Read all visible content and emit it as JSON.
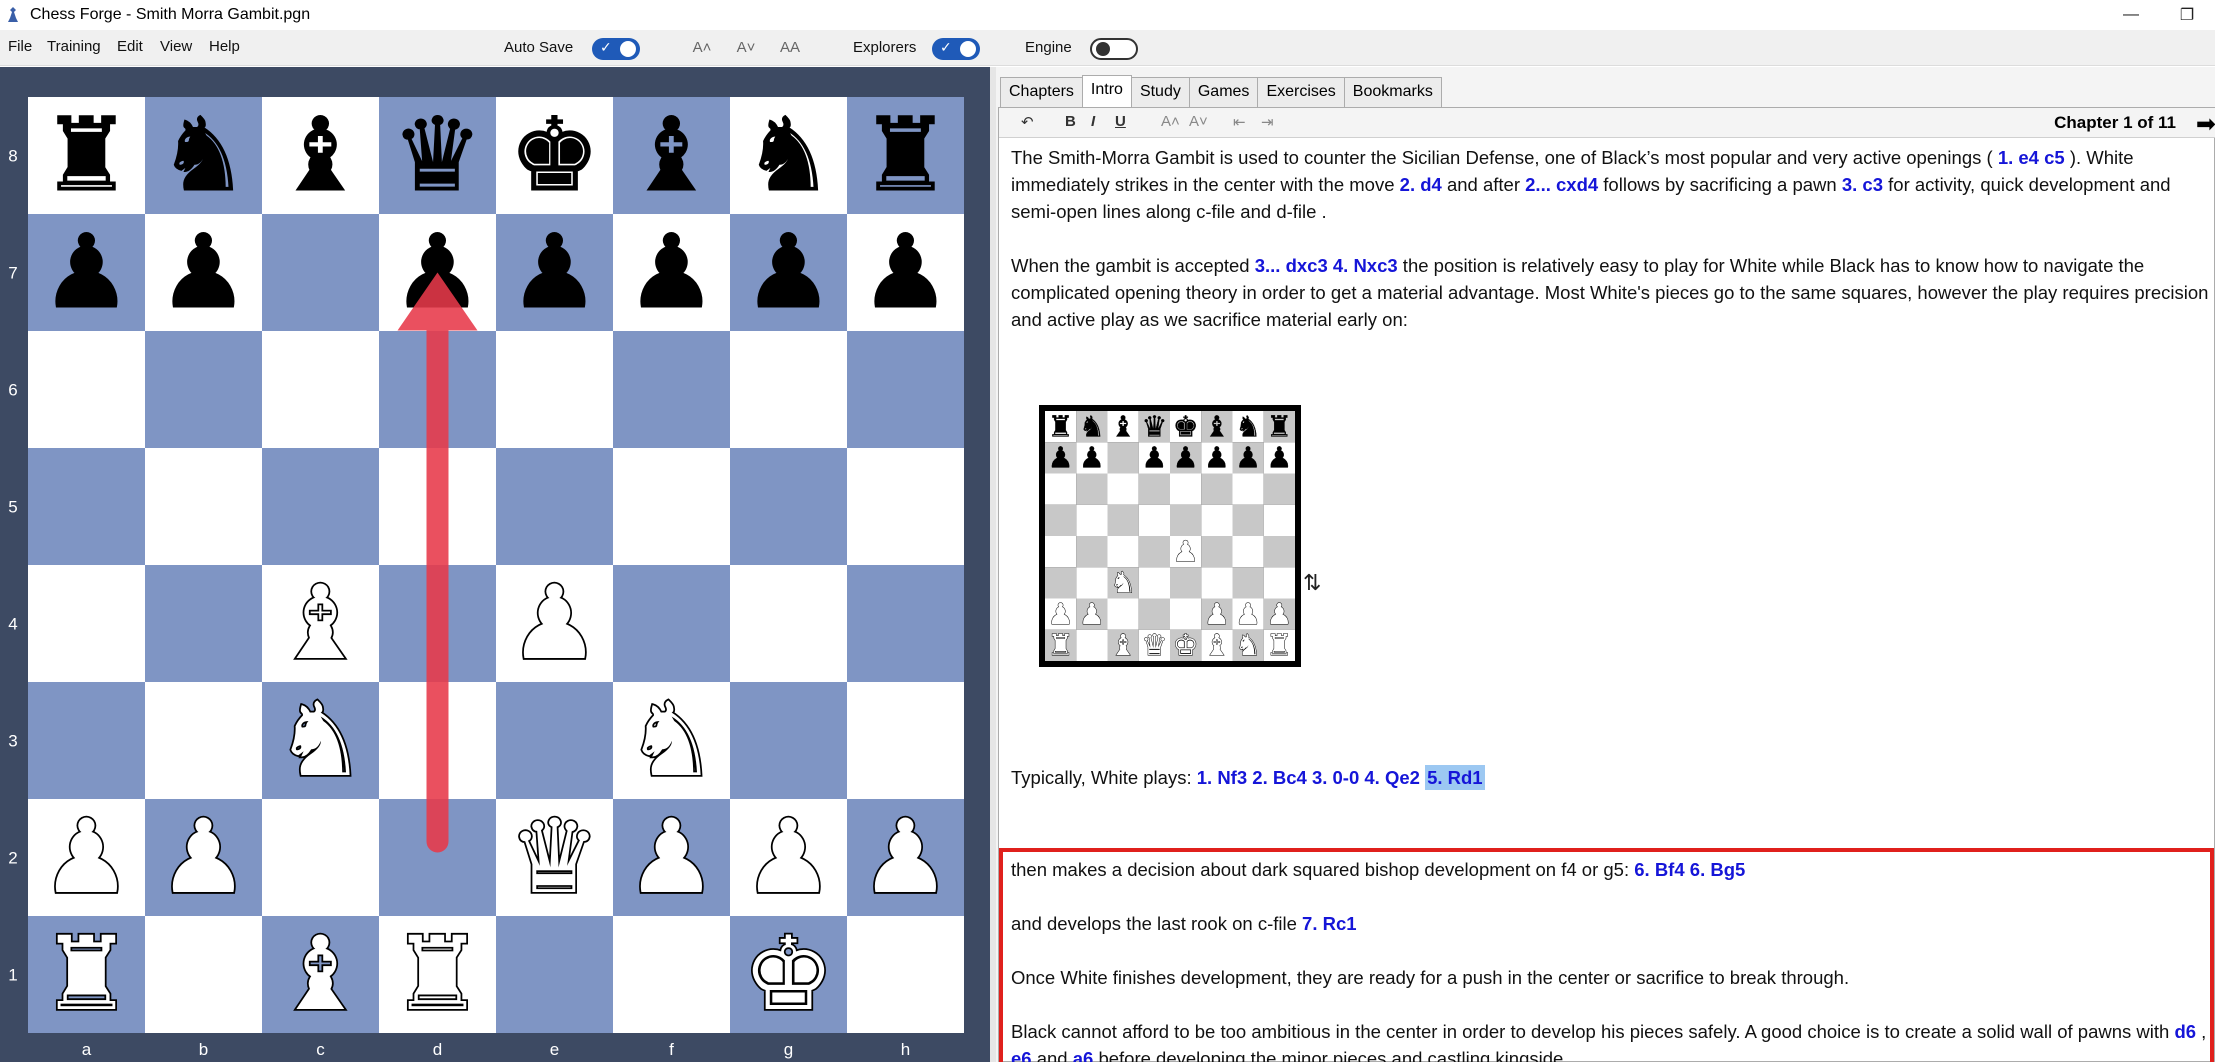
{
  "window": {
    "title": "Chess Forge - Smith Morra Gambit.pgn",
    "minimize_glyph": "—",
    "restore_glyph": "❐"
  },
  "menu": {
    "items": [
      "File",
      "Training",
      "Edit",
      "View",
      "Help"
    ],
    "auto_save_label": "Auto Save",
    "auto_save_on": true,
    "explorers_label": "Explorers",
    "explorers_on": true,
    "engine_label": "Engine",
    "engine_on": false,
    "font_buttons": [
      "A˄",
      "A˅",
      "AA"
    ]
  },
  "board": {
    "files": [
      "a",
      "b",
      "c",
      "d",
      "e",
      "f",
      "g",
      "h"
    ],
    "ranks": [
      "8",
      "7",
      "6",
      "5",
      "4",
      "3",
      "2",
      "1"
    ],
    "light_color": "#ffffff",
    "dark_color": "#7f95c4",
    "arrow_color": "#e8394a",
    "arrow": {
      "from": "d2",
      "to": "d7"
    },
    "position": [
      [
        "r",
        "n",
        "b",
        "q",
        "k",
        "b",
        "n",
        "r"
      ],
      [
        "p",
        "p",
        "",
        "p",
        "p",
        "p",
        "p",
        "p"
      ],
      [
        "",
        "",
        "",
        "",
        "",
        "",
        "",
        ""
      ],
      [
        "",
        "",
        "",
        "",
        "",
        "",
        "",
        ""
      ],
      [
        "",
        "",
        "B",
        "",
        "P",
        "",
        "",
        ""
      ],
      [
        "",
        "",
        "N",
        "",
        "",
        "N",
        "",
        ""
      ],
      [
        "P",
        "P",
        "",
        "",
        "Q",
        "P",
        "P",
        "P"
      ],
      [
        "R",
        "",
        "B",
        "R",
        "",
        "",
        "K",
        ""
      ]
    ]
  },
  "tabs": [
    "Chapters",
    "Intro",
    "Study",
    "Games",
    "Exercises",
    "Bookmarks"
  ],
  "active_tab": "Intro",
  "toolbar": {
    "buttons": [
      "↶",
      "B",
      "I",
      "U",
      "A˄",
      "A˅",
      "⇤",
      "⇥"
    ],
    "chapter_label": "Chapter 1 of 11",
    "next_arrow": "➡"
  },
  "intro": {
    "p1": [
      {
        "t": "The Smith-Morra Gambit is used to counter the Sicilian Defense, one of Black’s most popular and very active openings ( "
      },
      {
        "t": "1. e4",
        "m": true
      },
      {
        "t": "  "
      },
      {
        "t": "c5",
        "m": true
      },
      {
        "t": " ). White immediately strikes in the center with the move  "
      },
      {
        "t": "2. d4",
        "m": true
      },
      {
        "t": " and after "
      },
      {
        "t": "2... cxd4",
        "m": true
      },
      {
        "t": " follows by sacrificing a pawn  "
      },
      {
        "t": "3. c3",
        "m": true
      },
      {
        "t": " for activity, quick development and semi-open lines along c-file and d-file ."
      }
    ],
    "p2": [
      {
        "t": "When the gambit is accepted  "
      },
      {
        "t": "3... dxc3",
        "m": true
      },
      {
        "t": "  "
      },
      {
        "t": "4. Nxc3",
        "m": true
      },
      {
        "t": " the position is relatively easy to play for White while Black has to know how to navigate the complicated opening theory in order to get a material advantage. Most White's pieces go to the same squares, however the play requires precision and active play as we sacrifice material early on:"
      }
    ],
    "p3": [
      {
        "t": "Typically, White plays:  "
      },
      {
        "t": "1. Nf3",
        "m": true
      },
      {
        "t": "  "
      },
      {
        "t": "2. Bc4",
        "m": true
      },
      {
        "t": "  "
      },
      {
        "t": "3. 0-0",
        "m": true
      },
      {
        "t": "  "
      },
      {
        "t": "4. Qe2",
        "m": true
      },
      {
        "t": " "
      },
      {
        "t": "5. Rd1",
        "m": true,
        "h": true
      }
    ],
    "p4": [
      {
        "t": "then makes a decision about dark squared bishop development on f4 or g5:  "
      },
      {
        "t": "6. Bf4",
        "m": true
      },
      {
        "t": "  "
      },
      {
        "t": "6. Bg5",
        "m": true
      }
    ],
    "p5": [
      {
        "t": "and develops the last rook on c-file  "
      },
      {
        "t": "7. Rc1",
        "m": true
      }
    ],
    "p6": [
      {
        "t": "Once White finishes development, they are ready for a push in the center or sacrifice to break through."
      }
    ],
    "p7": [
      {
        "t": "Black cannot afford to be too ambitious in the center in order to develop his pieces safely. A good choice is to create a solid wall of pawns with  "
      },
      {
        "t": "d6",
        "m": true
      },
      {
        "t": " , "
      },
      {
        "t": "e6",
        "m": true
      },
      {
        "t": " and  "
      },
      {
        "t": "a6",
        "m": true
      },
      {
        "t": "  before developing the minor pieces and castling kingside."
      }
    ],
    "mini_board": {
      "light_color": "#ffffff",
      "dark_color": "#c8c8c8",
      "frame_color": "#000000",
      "position": [
        [
          "r",
          "n",
          "b",
          "q",
          "k",
          "b",
          "n",
          "r"
        ],
        [
          "p",
          "p",
          "",
          "p",
          "p",
          "p",
          "p",
          "p"
        ],
        [
          "",
          "",
          "",
          "",
          "",
          "",
          "",
          ""
        ],
        [
          "",
          "",
          "",
          "",
          "",
          "",
          "",
          ""
        ],
        [
          "",
          "",
          "",
          "",
          "P",
          "",
          "",
          ""
        ],
        [
          "",
          "",
          "N",
          "",
          "",
          "",
          "",
          ""
        ],
        [
          "P",
          "P",
          "",
          "",
          "",
          "P",
          "P",
          "P"
        ],
        [
          "R",
          "",
          "B",
          "Q",
          "K",
          "B",
          "N",
          "R"
        ]
      ]
    },
    "flip_icon": "⇅"
  }
}
